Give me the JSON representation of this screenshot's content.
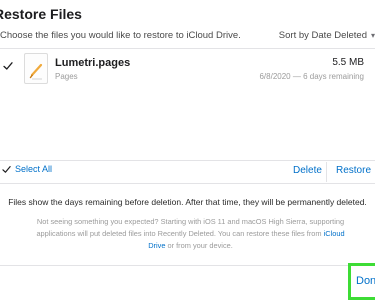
{
  "dialog": {
    "title": "Restore Files",
    "subtitle": "Choose the files you would like to restore to iCloud Drive.",
    "sort_label": "Sort by Date Deleted"
  },
  "files": [
    {
      "name": "Lumetri.pages",
      "type": "Pages",
      "size": "5.5 MB",
      "meta": "6/8/2020 — 6 days remaining",
      "selected": true
    }
  ],
  "actions": {
    "select_all": "Select All",
    "delete": "Delete",
    "restore": "Restore"
  },
  "info_text": "Files show the days remaining before deletion. After that time, they will be permanently deleted.",
  "help": {
    "text_before": "Not seeing something you expected? Starting with iOS 11 and macOS High Sierra, supporting applications will put deleted files into Recently Deleted. You can restore these files from ",
    "link_1": "iCloud",
    "link_2": "Drive",
    "text_after": " or from your device."
  },
  "footer": {
    "done_label": "Done"
  },
  "colors": {
    "accent": "#0070c9",
    "highlight": "#3ddc35"
  }
}
